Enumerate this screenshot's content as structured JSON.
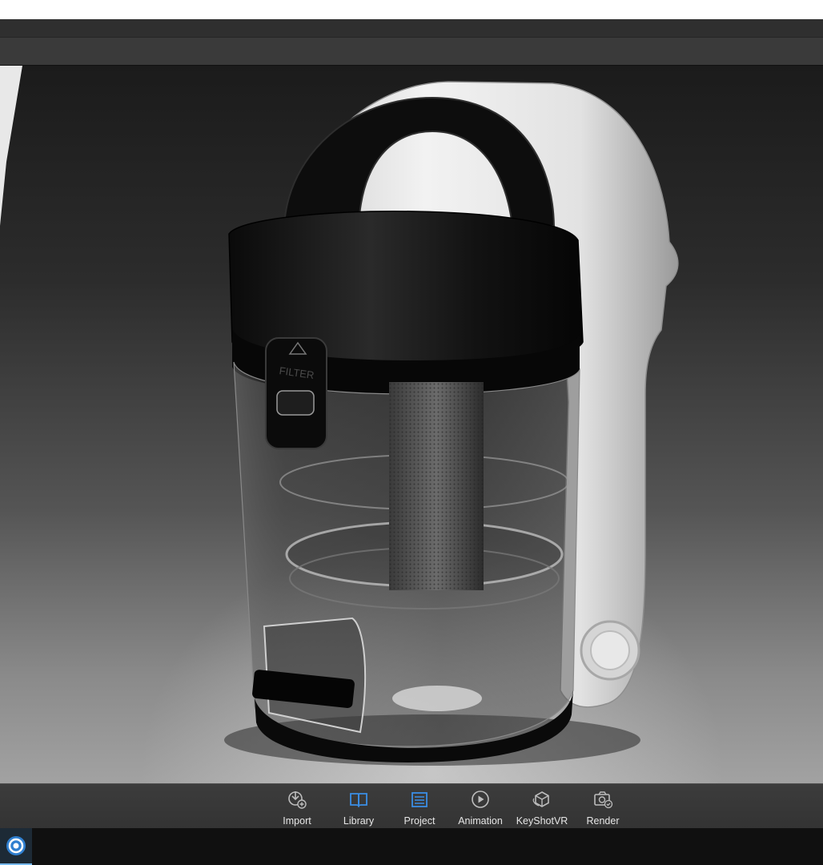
{
  "window": {
    "title": ""
  },
  "viewport": {
    "description_free": true,
    "filter_latch_text": "FILTER"
  },
  "ribbon": {
    "buttons": [
      {
        "label": "Import",
        "icon": "import-icon",
        "active": false
      },
      {
        "label": "Library",
        "icon": "library-icon",
        "active": true
      },
      {
        "label": "Project",
        "icon": "project-icon",
        "active": true
      },
      {
        "label": "Animation",
        "icon": "animation-icon",
        "active": false
      },
      {
        "label": "KeyShotVR",
        "icon": "keyshotvr-icon",
        "active": false
      },
      {
        "label": "Render",
        "icon": "render-icon",
        "active": false
      }
    ]
  },
  "colors": {
    "accent_blue": "#3a8ee6",
    "icon_gray": "#bdbdbd",
    "ribbon_bg": "#383838",
    "taskbar_bg": "#101010"
  },
  "taskbar": {
    "app_icon": "keyshot-app-icon"
  }
}
